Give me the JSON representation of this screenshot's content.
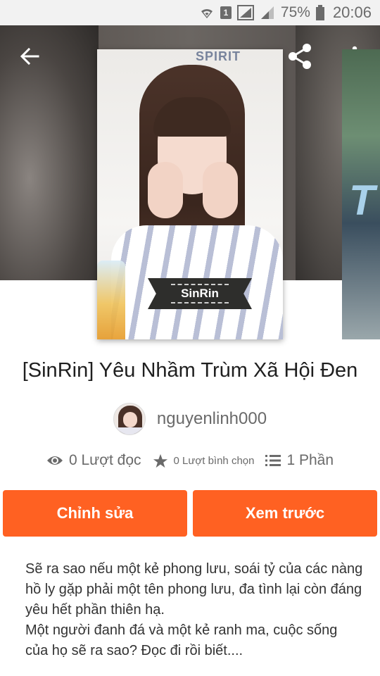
{
  "status_bar": {
    "battery": "75%",
    "time": "20:06",
    "sim_badge": "1"
  },
  "header": {
    "cover_label": "SinRin",
    "cover_watermark": "SPIRIT"
  },
  "story": {
    "title": "[SinRin] Yêu Nhầm Trùm Xã Hội Đen",
    "author": "nguyenlinh000",
    "reads": "0 Lượt đọc",
    "votes": "0 Lượt bình chọn",
    "parts": "1 Phần"
  },
  "actions": {
    "edit_label": "Chỉnh sửa",
    "preview_label": "Xem trước"
  },
  "description": {
    "line1": "Sẽ ra sao nếu một kẻ phong lưu, soái tỷ của các nàng hồ ly gặp phải một tên phong lưu, đa tình lại còn đáng yêu hết phần thiên hạ.",
    "line2": "Một người đanh đá và một kẻ ranh ma, cuộc sống của họ sẽ ra sao? Đọc đi rồi biết...."
  },
  "colors": {
    "accent": "#ff6122",
    "status_bg": "#f2f2f2",
    "text_muted": "#6a6a6a"
  },
  "icons": {
    "back": "arrow-left-icon",
    "share": "share-icon",
    "more": "more-vert-icon",
    "reads": "eye-icon",
    "votes": "star-icon",
    "parts": "list-icon"
  }
}
